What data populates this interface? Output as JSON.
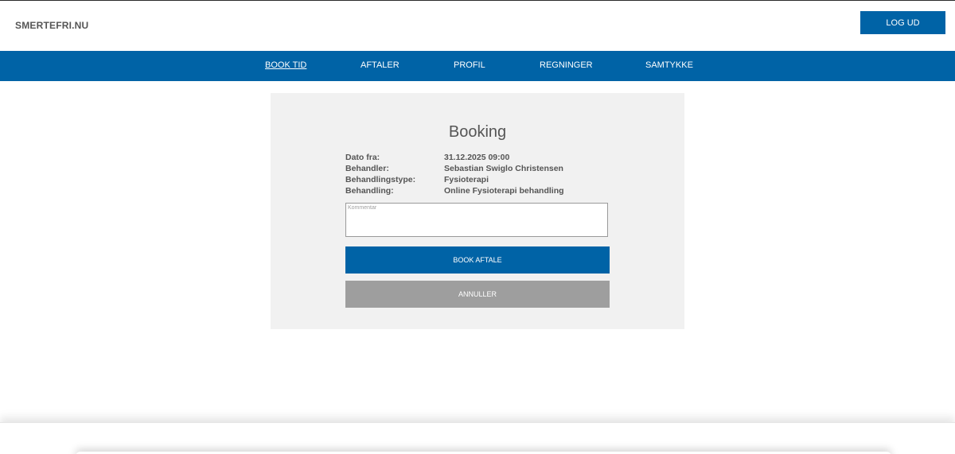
{
  "header": {
    "logo": "SMERTEFRI.NU",
    "logout_label": "LOG UD"
  },
  "nav": {
    "items": [
      {
        "label": "BOOK TID",
        "active": true
      },
      {
        "label": "AFTALER",
        "active": false
      },
      {
        "label": "PROFIL",
        "active": false
      },
      {
        "label": "REGNINGER",
        "active": false
      },
      {
        "label": "SAMTYKKE",
        "active": false
      }
    ]
  },
  "booking": {
    "title": "Booking",
    "details": [
      {
        "label": "Dato fra:",
        "value": "31.12.2025 09:00"
      },
      {
        "label": "Behandler:",
        "value": "Sebastian Swiglo Christensen"
      },
      {
        "label": "Behandlingstype:",
        "value": "Fysioterapi"
      },
      {
        "label": "Behandling:",
        "value": "Online Fysioterapi behandling"
      }
    ],
    "comment": {
      "placeholder": "Kommentar",
      "value": ""
    },
    "book_label": "BOOK AFTALE",
    "cancel_label": "ANNULLER"
  },
  "colors": {
    "brand": "#0063a6",
    "cancel": "#9e9e9e",
    "card_bg": "#f1f1f1",
    "text": "#555555"
  }
}
